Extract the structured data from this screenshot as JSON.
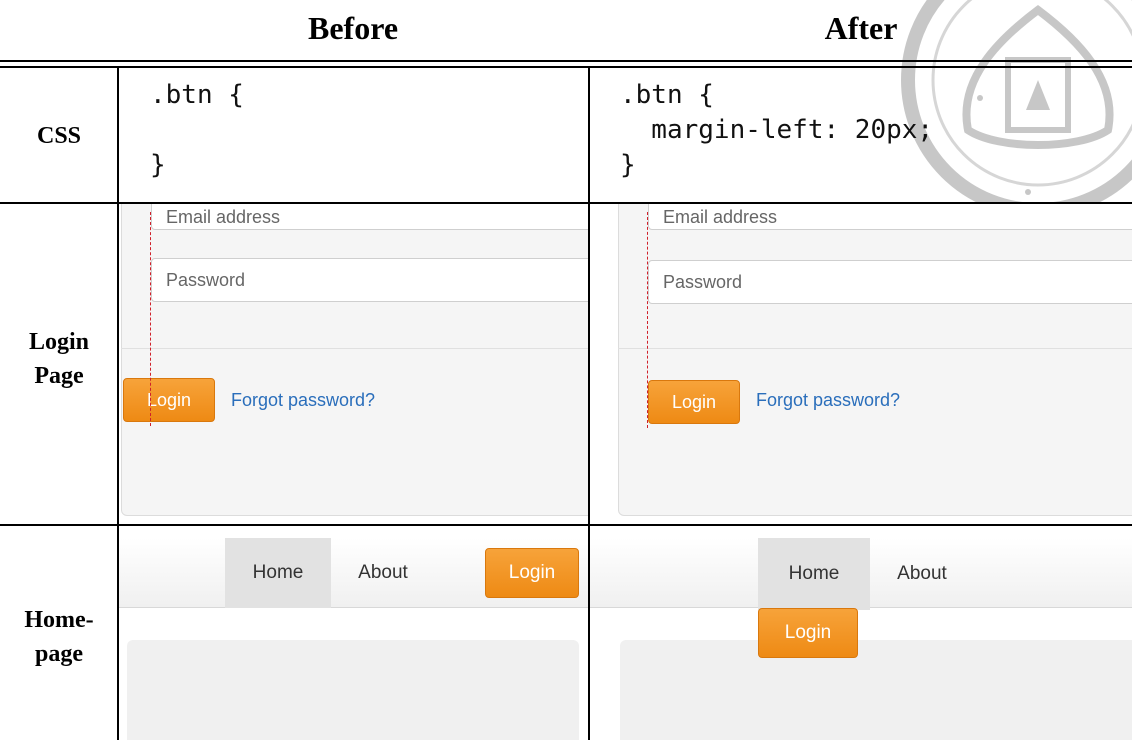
{
  "headers": {
    "before": "Before",
    "after": "After"
  },
  "rows": {
    "css": "CSS",
    "login_line1": "Login",
    "login_line2": "Page",
    "home_line1": "Home-",
    "home_line2": "page"
  },
  "code_before": {
    "line1": ".btn {",
    "line3": "}"
  },
  "code_after": {
    "line1": ".btn {",
    "line2": "  margin-left: 20px;",
    "line3": "}"
  },
  "login": {
    "email_placeholder": "Email address",
    "password_placeholder": "Password",
    "login_button": "Login",
    "forgot_link": "Forgot password?"
  },
  "home": {
    "nav_home": "Home",
    "nav_about": "About",
    "login_button": "Login"
  },
  "colors": {
    "accent_orange": "#ee8a14",
    "code_property": "#c2185b",
    "link_blue": "#2a6ebb",
    "guide_red": "#d0202a"
  }
}
